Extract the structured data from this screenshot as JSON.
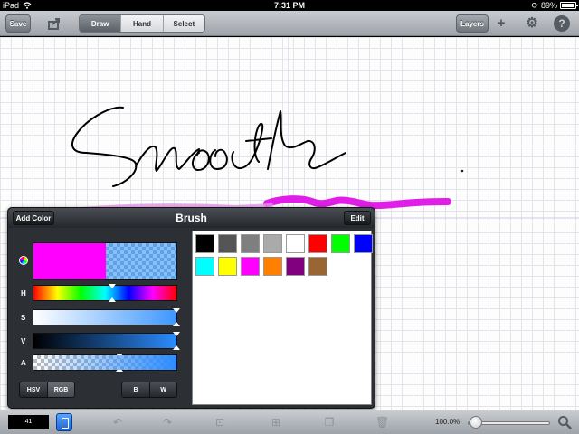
{
  "status": {
    "device": "iPad",
    "time": "7:31 PM",
    "battery": "89%"
  },
  "toolbar": {
    "save_label": "Save",
    "modes": [
      "Draw",
      "Hand",
      "Select"
    ],
    "active_mode": "Draw",
    "layers_label": "Layers",
    "icons": [
      "share-icon",
      "plus-icon",
      "gear-icon",
      "help-icon"
    ]
  },
  "canvas": {
    "drawn_word": "Smooth"
  },
  "panel": {
    "title": "Brush",
    "add_color_label": "Add Color",
    "edit_label": "Edit",
    "current_color": "#ff00ff",
    "alpha_color": "#1e8cff",
    "sliders": [
      {
        "label": "H",
        "value": 0.55
      },
      {
        "label": "S",
        "value": 1.0
      },
      {
        "label": "V",
        "value": 1.0
      },
      {
        "label": "A",
        "value": 0.6
      }
    ],
    "modes": [
      "HSV",
      "RGB"
    ],
    "active_mode": "RGB",
    "bw": [
      "B",
      "W"
    ],
    "palette": [
      "#000000",
      "#555555",
      "#7f7f7f",
      "#aaaaaa",
      "#ffffff",
      "#ff0000",
      "#00ff00",
      "#0000ff",
      "#00ffff",
      "#ffff00",
      "#ff00ff",
      "#ff8000",
      "#800080",
      "#996633"
    ]
  },
  "bottombar": {
    "brush_size": "41",
    "zoom_label": "100.0%",
    "zoom_level": 0.03,
    "icons": [
      "brush-icon",
      "undo-icon",
      "redo-icon",
      "crop-icon",
      "transform-icon",
      "layers-copy-icon",
      "trash-icon",
      "zoom-icon"
    ]
  }
}
